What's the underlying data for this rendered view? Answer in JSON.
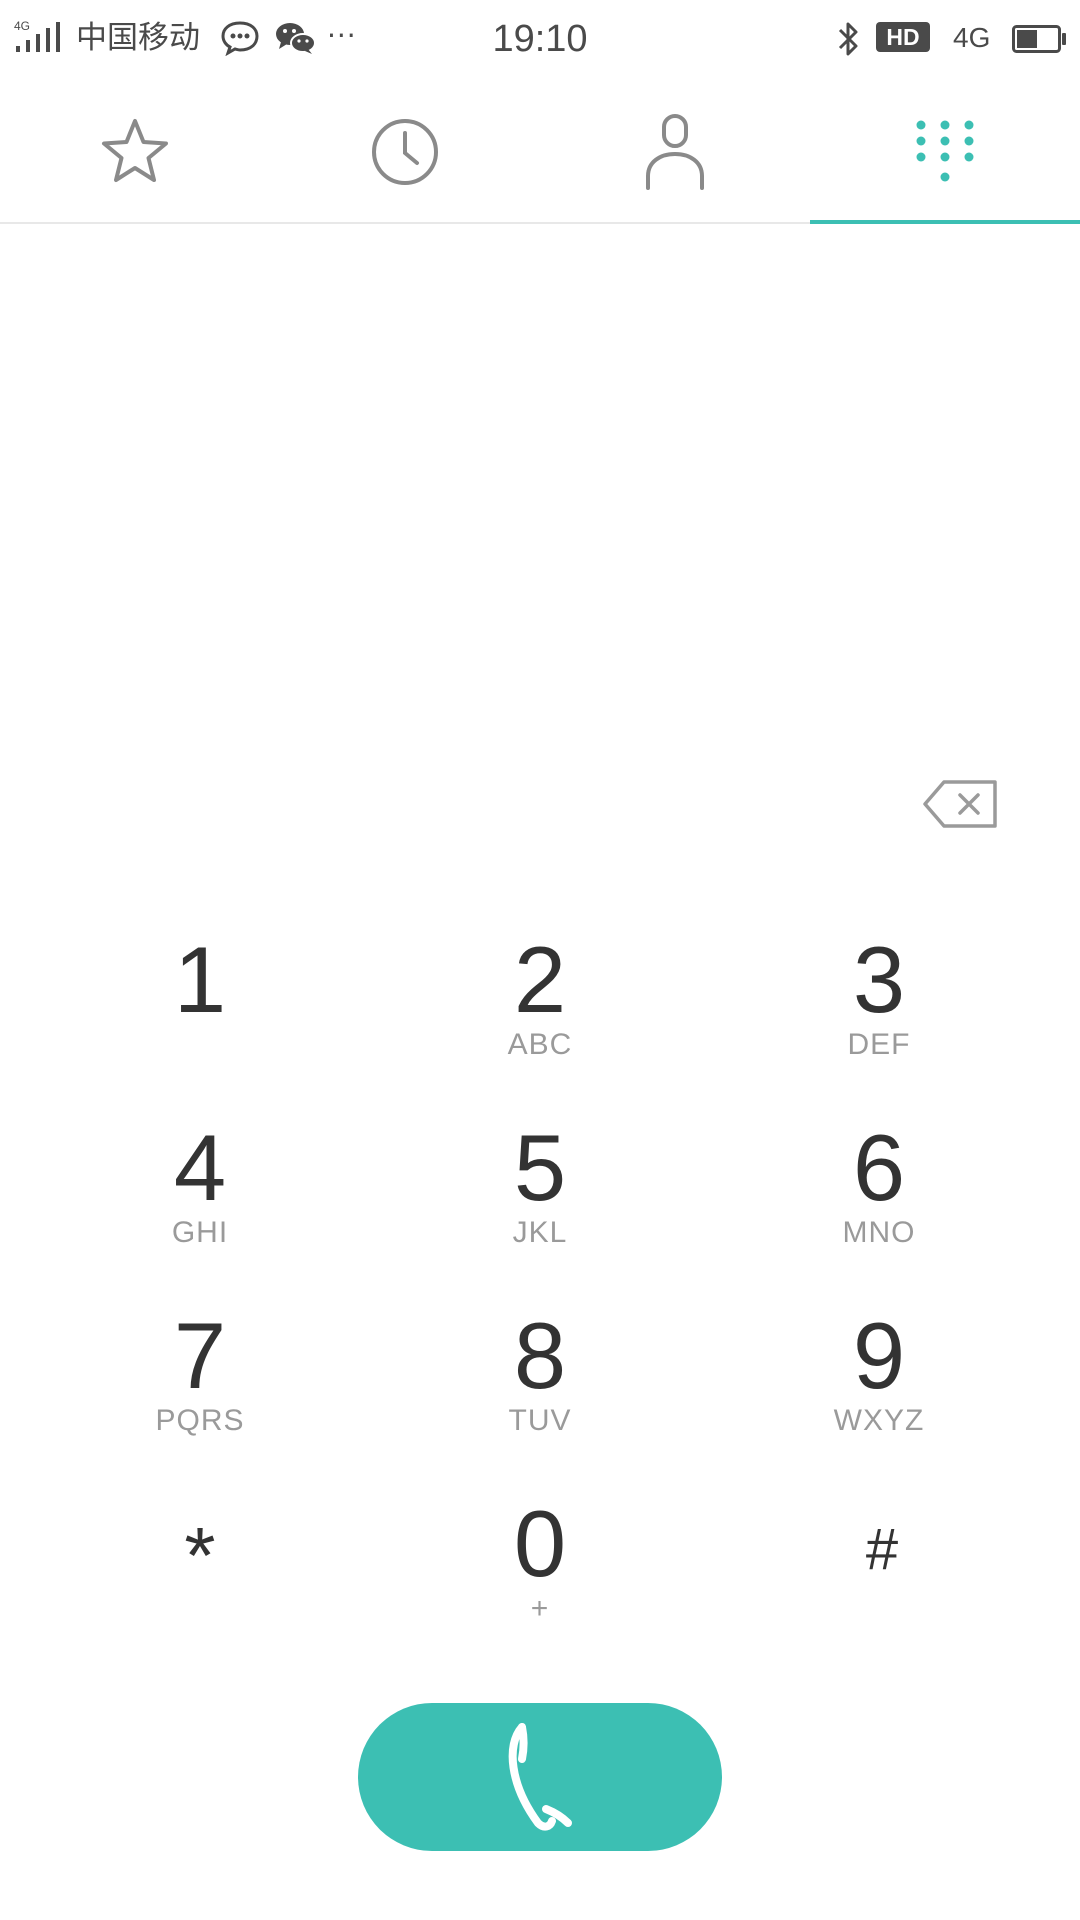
{
  "status_bar": {
    "signal_label": "4G",
    "carrier": "中国移动",
    "more": "···",
    "time": "19:10",
    "hd_badge": "HD",
    "network": "4G",
    "battery_level": 0.5,
    "icons": [
      "signal-icon",
      "message-icon",
      "wechat-icon",
      "bluetooth-icon",
      "battery-icon"
    ]
  },
  "tabs": [
    {
      "name": "favorites",
      "icon": "star-icon",
      "active": false
    },
    {
      "name": "recents",
      "icon": "clock-icon",
      "active": false
    },
    {
      "name": "contacts",
      "icon": "person-icon",
      "active": false
    },
    {
      "name": "dialpad",
      "icon": "dialpad-icon",
      "active": true
    }
  ],
  "dialer": {
    "number": ""
  },
  "keypad": {
    "keys": [
      {
        "digit": "1",
        "letters": ""
      },
      {
        "digit": "2",
        "letters": "ABC"
      },
      {
        "digit": "3",
        "letters": "DEF"
      },
      {
        "digit": "4",
        "letters": "GHI"
      },
      {
        "digit": "5",
        "letters": "JKL"
      },
      {
        "digit": "6",
        "letters": "MNO"
      },
      {
        "digit": "7",
        "letters": "PQRS"
      },
      {
        "digit": "8",
        "letters": "TUV"
      },
      {
        "digit": "9",
        "letters": "WXYZ"
      },
      {
        "digit": "*",
        "letters": ""
      },
      {
        "digit": "0",
        "letters": "+"
      },
      {
        "digit": "#",
        "letters": ""
      }
    ]
  },
  "colors": {
    "accent": "#3cbfb3",
    "icon_gray": "#8a8a8a",
    "digit": "#333333",
    "letters": "#9a9a9a"
  }
}
